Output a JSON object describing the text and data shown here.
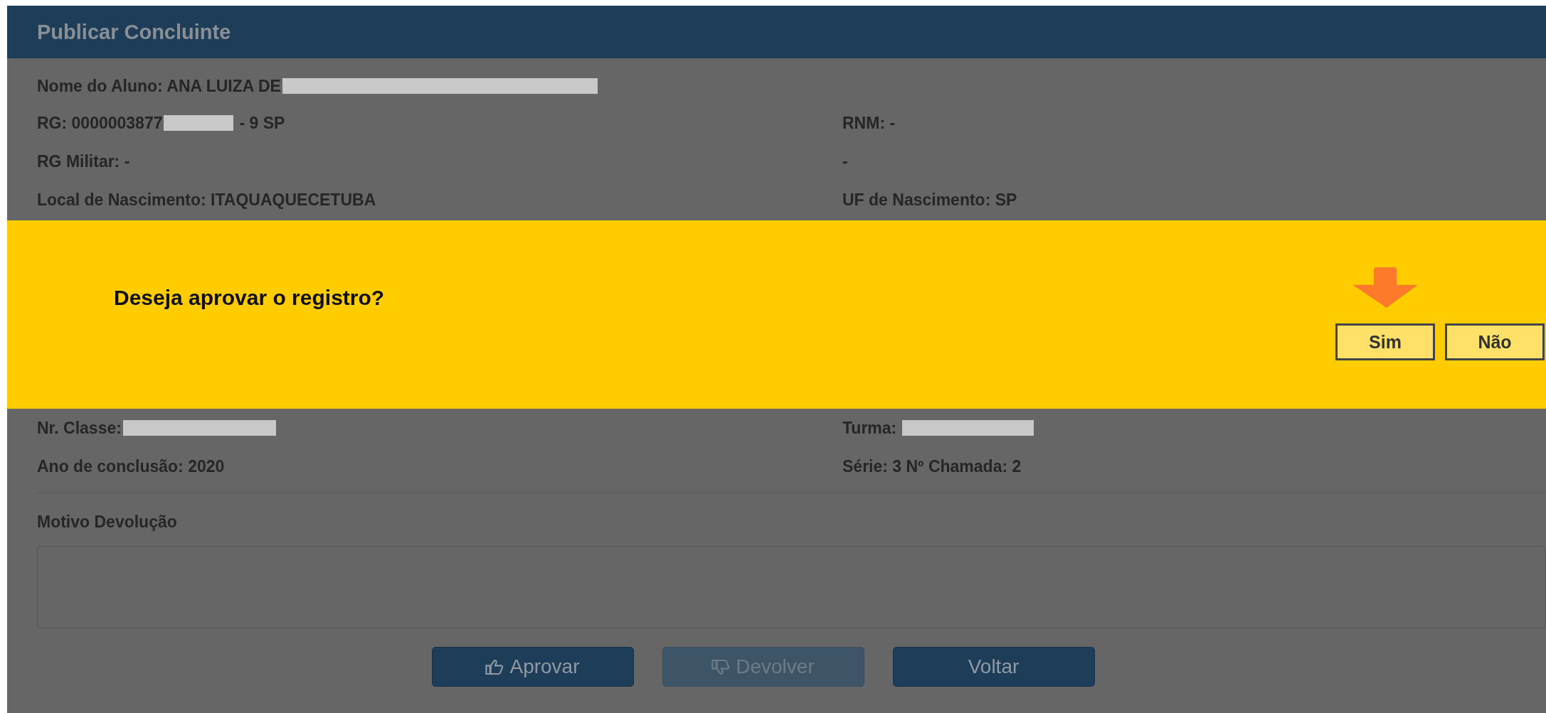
{
  "panel": {
    "title": "Publicar Concluinte"
  },
  "rows_top": [
    {
      "left": [
        {
          "kind": "text",
          "text": "Nome do Aluno: ANA LUIZA DE"
        },
        {
          "kind": "redaction"
        }
      ]
    },
    {
      "left": [
        {
          "kind": "text",
          "text": "RG: 0000003877"
        },
        {
          "kind": "redaction"
        },
        {
          "kind": "text",
          "text": "- 9 SP"
        }
      ],
      "right": [
        {
          "kind": "text",
          "text": "RNM: -"
        }
      ]
    },
    {
      "left": [
        {
          "kind": "text",
          "text": "RG Militar: -"
        }
      ],
      "right": [
        {
          "kind": "text",
          "text": "-"
        }
      ]
    },
    {
      "left": [
        {
          "kind": "text",
          "text": "Local de Nascimento: ITAQUAQUECETUBA"
        }
      ],
      "right": [
        {
          "kind": "text",
          "text": "UF de Nascimento: SP"
        }
      ]
    }
  ],
  "rows_bottom": [
    {
      "left": [
        {
          "kind": "text",
          "text": "Nr. Classe:"
        },
        {
          "kind": "redaction"
        }
      ],
      "right": [
        {
          "kind": "text",
          "text": "Turma:"
        },
        {
          "kind": "redaction"
        }
      ]
    },
    {
      "left": [
        {
          "kind": "text",
          "text": "Ano de conclusão: 2020"
        }
      ],
      "right": [
        {
          "kind": "text",
          "text": "Série: 3 Nº Chamada: 2"
        }
      ]
    }
  ],
  "reason": {
    "label": "Motivo Devolução"
  },
  "actions": [
    {
      "label": "Aprovar",
      "disabled": false
    },
    {
      "label": "Devolver",
      "disabled": true
    },
    {
      "label": "Voltar",
      "disabled": false
    }
  ],
  "dialog": {
    "message": "Deseja aprovar o registro?",
    "buttons": [
      {
        "label": "Sim",
        "pointed": true
      },
      {
        "label": "Não",
        "pointed": false
      }
    ]
  }
}
